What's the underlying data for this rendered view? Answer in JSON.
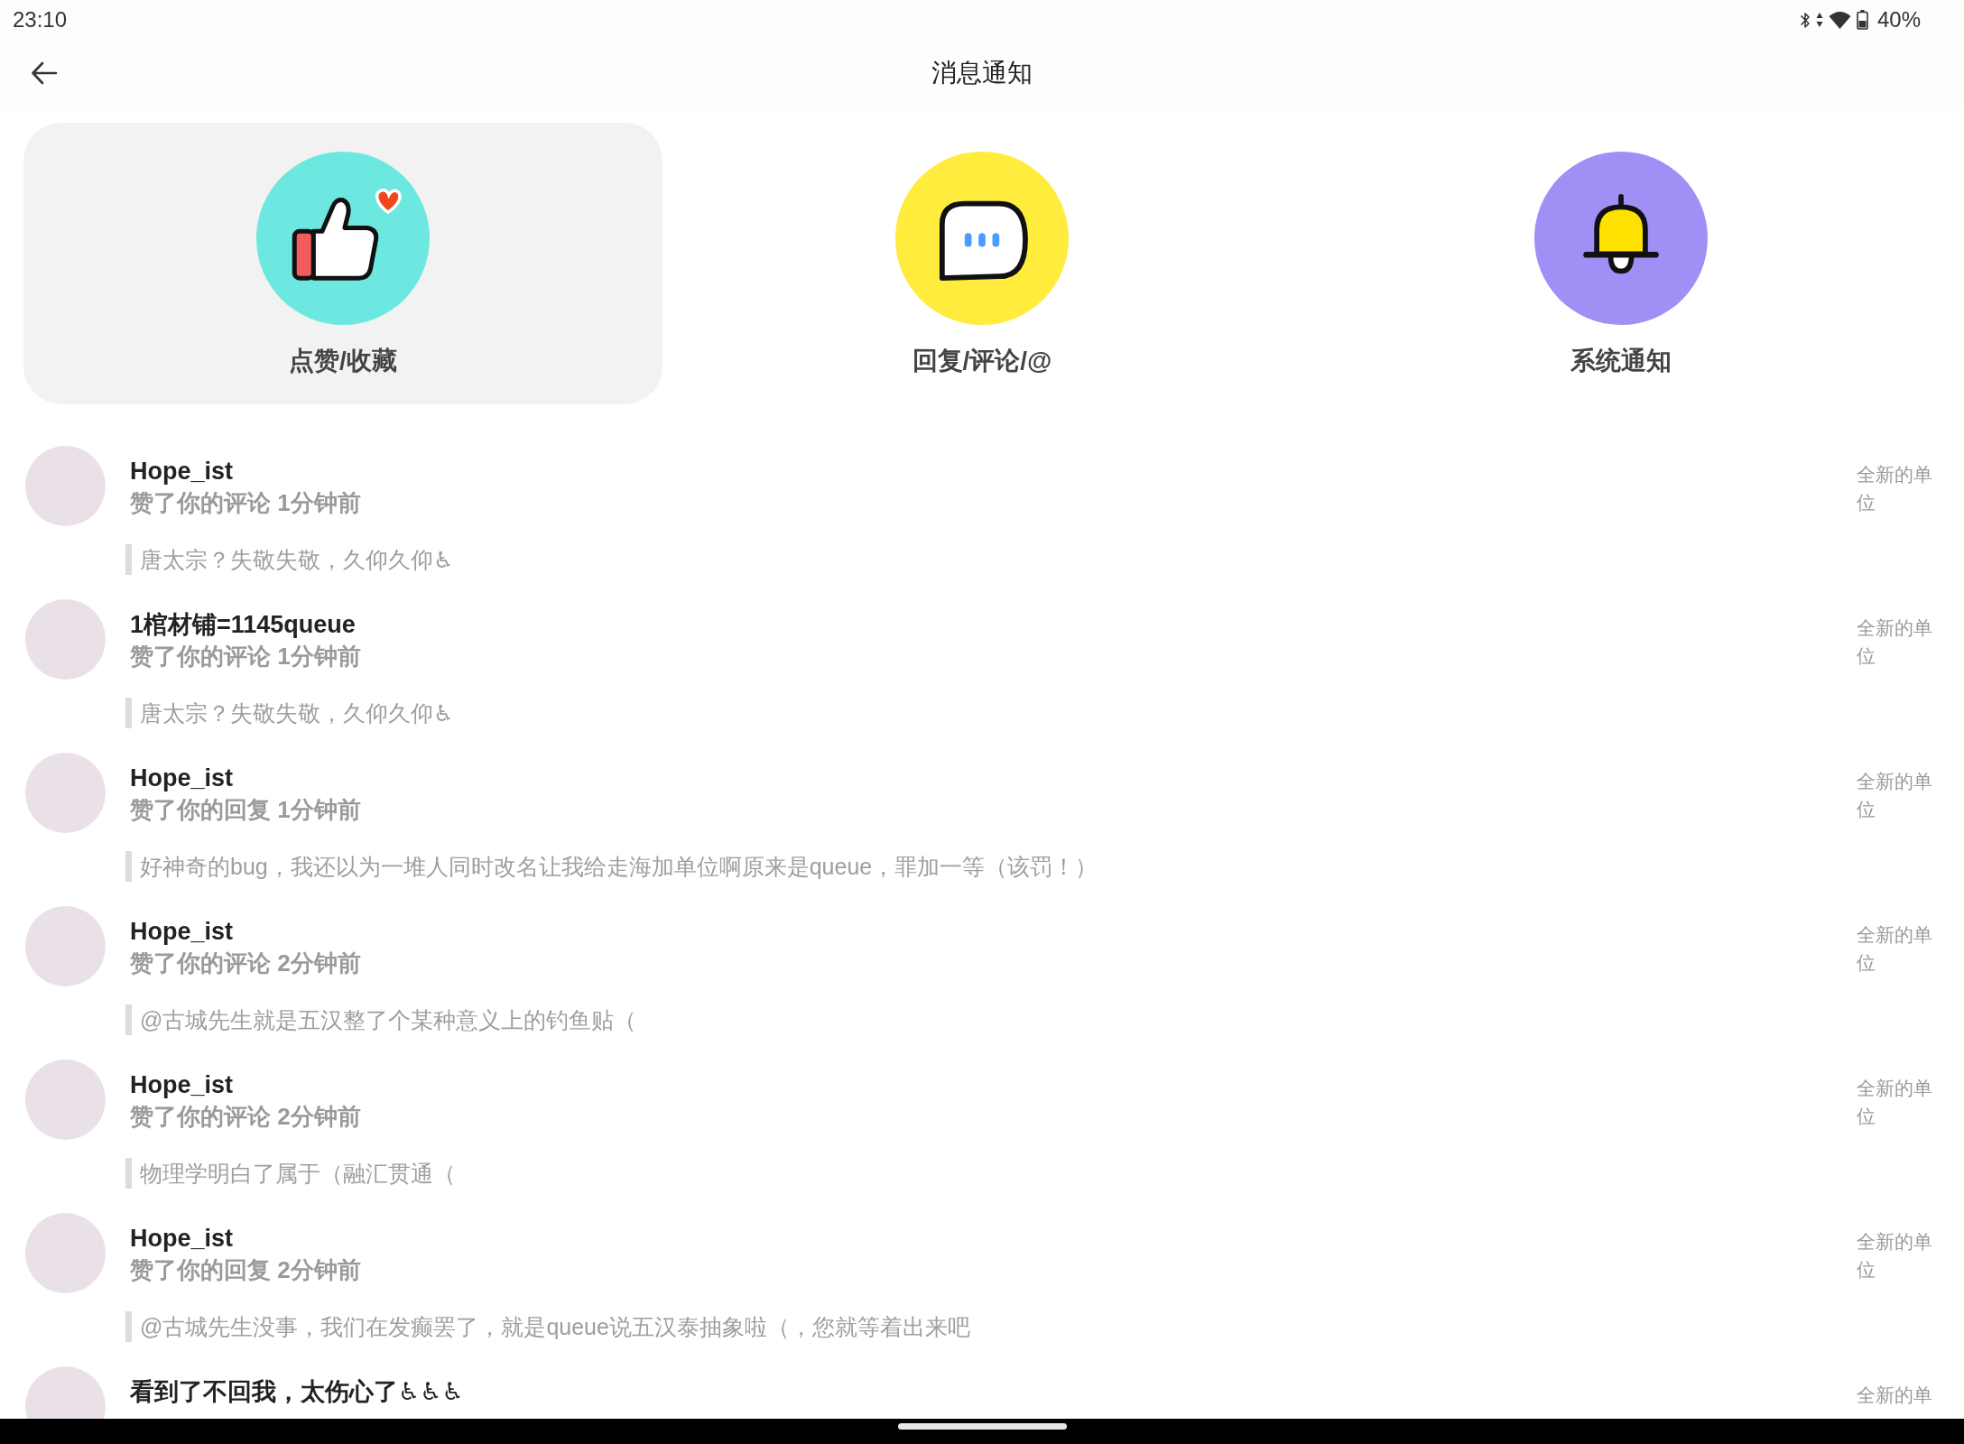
{
  "status_bar": {
    "time": "23:10",
    "battery": "40%"
  },
  "header": {
    "title": "消息通知"
  },
  "categories": [
    {
      "kind": "like",
      "label": "点赞/收藏",
      "color": "#6ce8e1",
      "selected": true
    },
    {
      "kind": "reply",
      "label": "回复/评论/@",
      "color": "#ffec3d",
      "selected": false
    },
    {
      "kind": "system",
      "label": "系统通知",
      "color": "#9f90f6",
      "selected": false
    }
  ],
  "notifications": [
    {
      "name": "Hope_ist",
      "action": "赞了你的评论 1分钟前",
      "comment": "唐太宗？失敬失敬，久仰久仰♿",
      "source": "全新的单位"
    },
    {
      "name": "1棺材铺=1145queue",
      "action": "赞了你的评论 1分钟前",
      "comment": "唐太宗？失敬失敬，久仰久仰♿",
      "source": "全新的单位"
    },
    {
      "name": "Hope_ist",
      "action": "赞了你的回复 1分钟前",
      "comment": "好神奇的bug，我还以为一堆人同时改名让我给走海加单位啊原来是queue，罪加一等（该罚！）",
      "source": "全新的单位"
    },
    {
      "name": "Hope_ist",
      "action": "赞了你的评论 2分钟前",
      "comment": "@古城先生就是五汉整了个某种意义上的钓鱼贴（",
      "source": "全新的单位"
    },
    {
      "name": "Hope_ist",
      "action": "赞了你的评论 2分钟前",
      "comment": "物理学明白了属于（融汇贯通（",
      "source": "全新的单位"
    },
    {
      "name": "Hope_ist",
      "action": "赞了你的回复 2分钟前",
      "comment": "@古城先生没事，我们在发癫罢了，就是queue说五汉泰抽象啦（，您就等着出来吧",
      "source": "全新的单位"
    },
    {
      "name": "看到了不回我，太伤心了♿♿♿",
      "source": "全新的单"
    }
  ]
}
